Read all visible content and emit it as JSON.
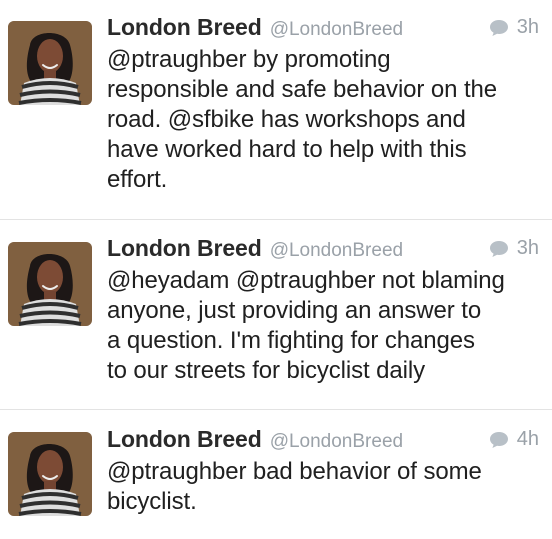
{
  "tweets": [
    {
      "display_name": "London Breed",
      "handle": "@LondonBreed",
      "time": "3h",
      "text": "@ptraughber by promoting\nresponsible and safe behavior on the\nroad. @sfbike has workshops and\nhave worked hard to help with this\neffort."
    },
    {
      "display_name": "London Breed",
      "handle": "@LondonBreed",
      "time": "3h",
      "text": "@heyadam @ptraughber not blaming\nanyone, just providing an answer to\na question. I'm fighting for changes\nto our streets for bicyclist daily"
    },
    {
      "display_name": "London Breed",
      "handle": "@LondonBreed",
      "time": "4h",
      "text": "@ptraughber bad behavior of some\nbicyclist."
    }
  ],
  "colors": {
    "name": "#2a2a2a",
    "meta": "#9aa1a8",
    "text": "#202020",
    "divider": "#e3e3e3"
  },
  "icons": {
    "reply": "speech-bubble-icon",
    "avatar": "profile-photo"
  }
}
